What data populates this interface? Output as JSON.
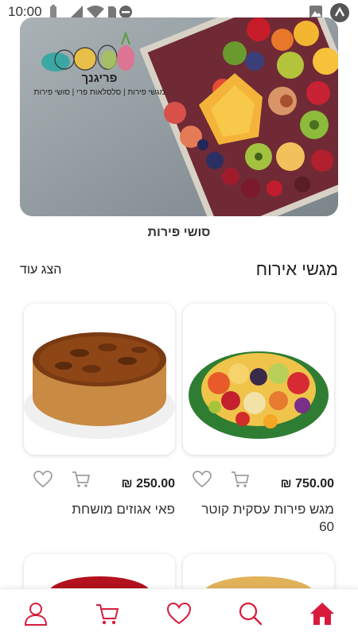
{
  "status_bar": {
    "time": "10:00"
  },
  "hero": {
    "logo_title": "פריגנך",
    "logo_tagline": "מגשי פירות | סלסלאות פרי | סושי פירות",
    "caption": "סושי פירות"
  },
  "section": {
    "title": "מגשי אירוח",
    "show_more": "הצג עוד"
  },
  "products": [
    {
      "name": "מגש פירות עסקית קוטר 60",
      "price": "750.00 ₪",
      "image": "fruit-platter"
    },
    {
      "name": "פאי אגוזים מושחת",
      "price": "250.00 ₪",
      "image": "pecan-pie"
    }
  ],
  "bottom_nav": [
    "profile-icon",
    "cart-icon",
    "heart-icon",
    "search-icon",
    "home-icon"
  ],
  "colors": {
    "accent": "#d81b3c",
    "icon_gray": "#9e9e9e",
    "text": "#222222"
  }
}
